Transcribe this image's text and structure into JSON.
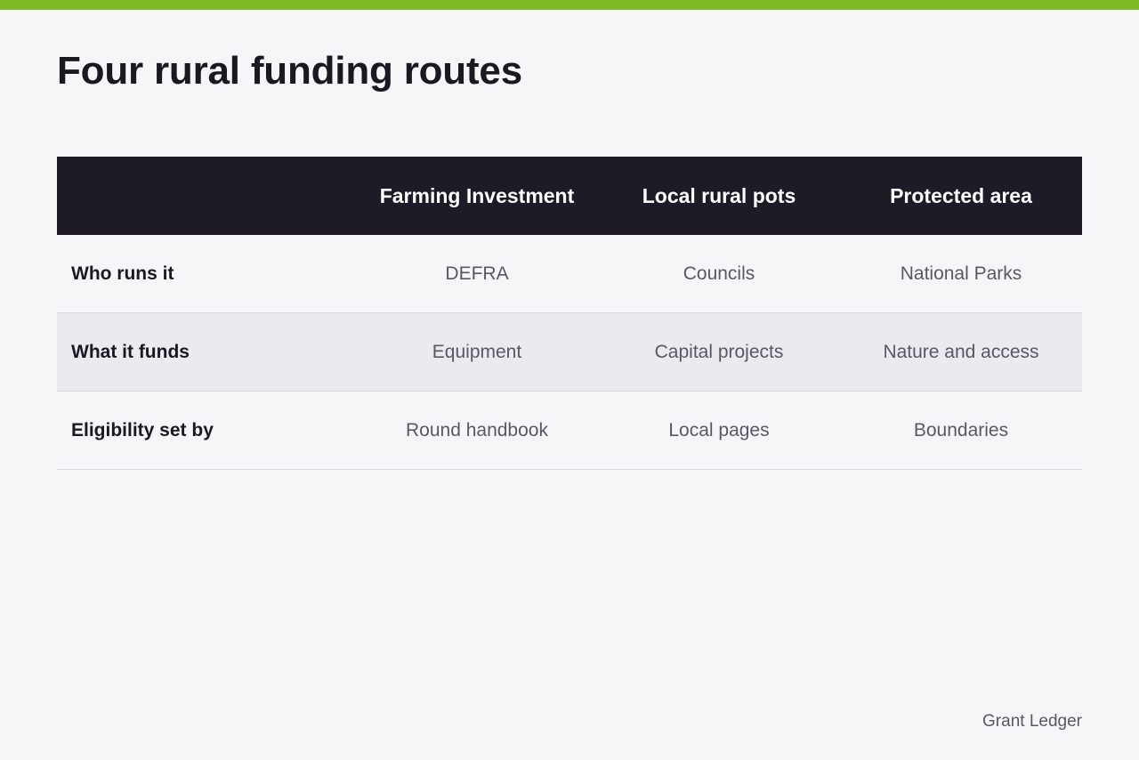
{
  "colors": {
    "accent": "#7cbc22",
    "header_bg": "#1e1a26",
    "page_bg": "#f6f6f9",
    "alt_row_bg": "#ebeaef"
  },
  "title": "Four rural funding routes",
  "table": {
    "columns": [
      "",
      "Farming Investment",
      "Local rural pots",
      "Protected area"
    ],
    "rows": [
      {
        "label": "Who runs it",
        "cells": [
          "DEFRA",
          "Councils",
          "National Parks"
        ]
      },
      {
        "label": "What it funds",
        "cells": [
          "Equipment",
          "Capital projects",
          "Nature and access"
        ]
      },
      {
        "label": "Eligibility set by",
        "cells": [
          "Round handbook",
          "Local pages",
          "Boundaries"
        ]
      }
    ]
  },
  "footer": "Grant Ledger"
}
